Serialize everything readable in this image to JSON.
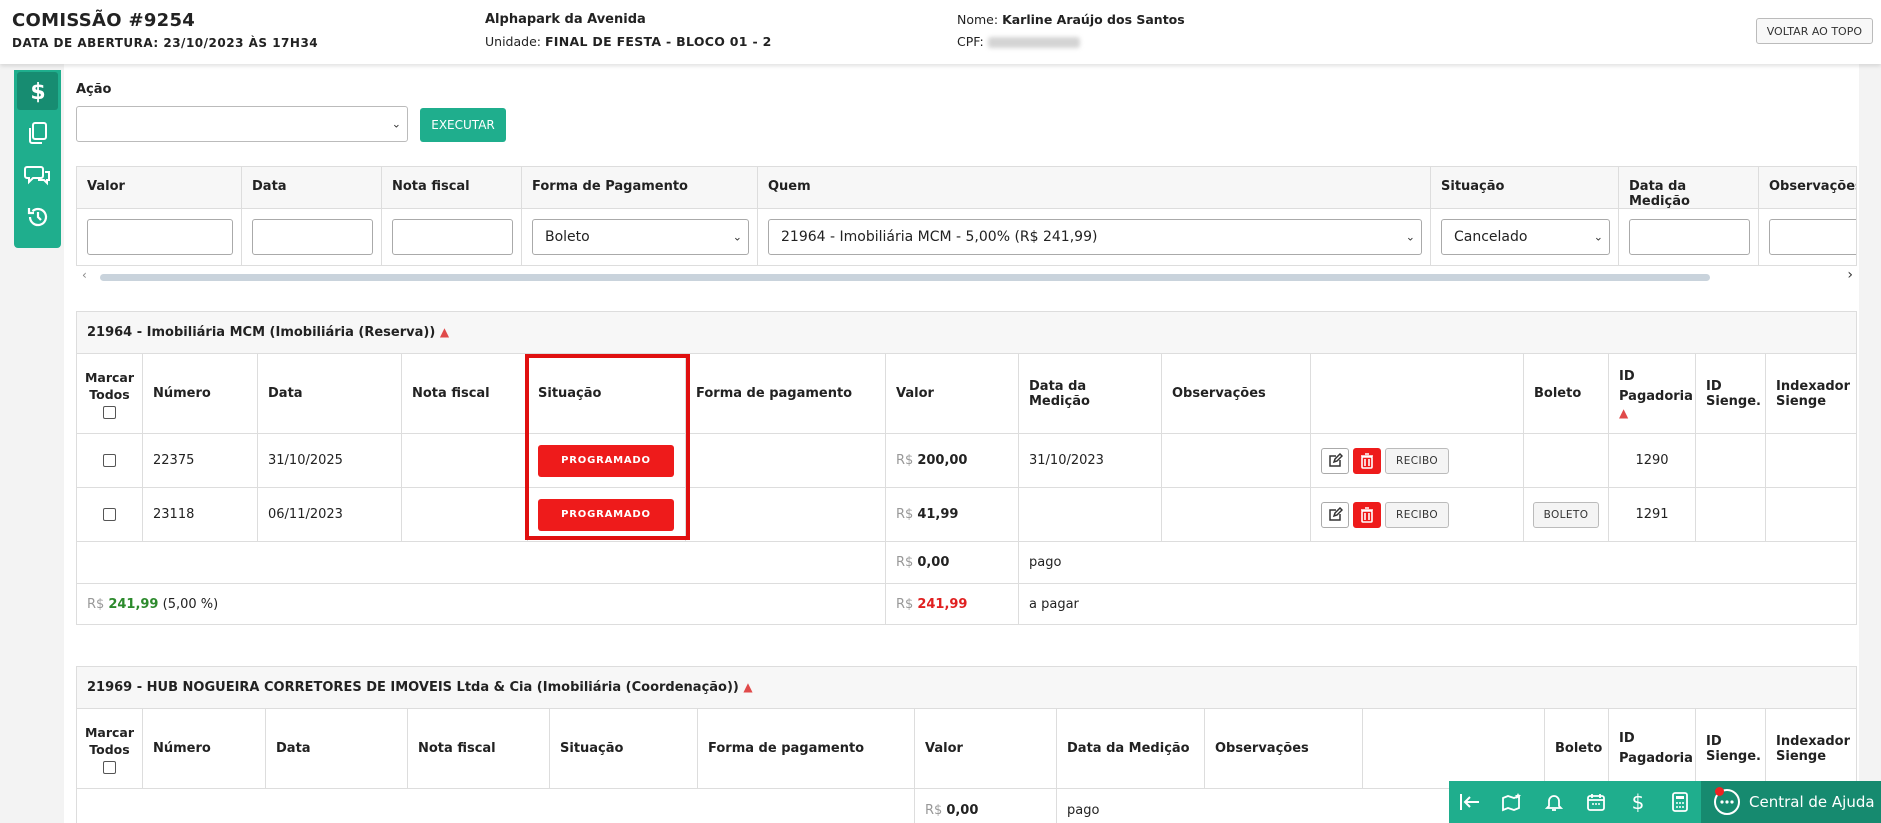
{
  "header": {
    "title": "COMISSÃO #9254",
    "opening": "DATA DE ABERTURA: 23/10/2023 ÀS 17H34",
    "project": "Alphapark da Avenida",
    "unit_label": "Unidade:",
    "unit_value": "FINAL DE FESTA - BLOCO 01 - 2",
    "name_label": "Nome:",
    "name_value": "Karline Araújo dos Santos",
    "cpf_label": "CPF:",
    "back_to_top": "VOLTAR AO TOPO"
  },
  "action": {
    "label": "Ação",
    "select_value": "",
    "execute": "EXECUTAR"
  },
  "filter": {
    "headers": [
      "Valor",
      "Data",
      "Nota fiscal",
      "Forma de Pagamento",
      "Quem",
      "Situação",
      "Data da Medição",
      "Observações"
    ],
    "forma_pagamento": "Boleto",
    "quem": "21964 - Imobiliária MCM - 5,00% (R$ 241,99)",
    "situacao": "Cancelado"
  },
  "group1": {
    "title": "21964 - Imobiliária MCM (Imobiliária (Reserva))",
    "headers": {
      "marcar": "Marcar Todos",
      "numero": "Número",
      "data": "Data",
      "nota": "Nota fiscal",
      "situacao": "Situação",
      "forma": "Forma de pagamento",
      "valor": "Valor",
      "medicao": "Data da Medição",
      "obs": "Observações",
      "boleto": "Boleto",
      "idpag": "ID Pagadoria",
      "idsienge": "ID Sienge.",
      "indexador": "Indexador Sienge"
    },
    "rows": [
      {
        "numero": "22375",
        "data": "31/10/2025",
        "situacao": "PROGRAMADO",
        "currency": "R$",
        "valor": "200,00",
        "medicao": "31/10/2023",
        "recibo": "RECIBO",
        "boleto": "",
        "idpag": "1290"
      },
      {
        "numero": "23118",
        "data": "06/11/2023",
        "situacao": "PROGRAMADO",
        "currency": "R$",
        "valor": "41,99",
        "medicao": "",
        "recibo": "RECIBO",
        "boleto": "BOLETO",
        "idpag": "1291"
      }
    ],
    "paid_currency": "R$",
    "paid_value": "0,00",
    "paid_label": "pago",
    "total_currency": "R$",
    "total_value": "241,99",
    "total_percent": "(5,00 %)",
    "topay_currency": "R$",
    "topay_value": "241,99",
    "topay_label": "a pagar"
  },
  "group2": {
    "title": "21969 - HUB NOGUEIRA CORRETORES DE IMOVEIS Ltda & Cia (Imobiliária (Coordenação))",
    "headers": {
      "marcar": "Marcar Todos",
      "numero": "Número",
      "data": "Data",
      "nota": "Nota fiscal",
      "situacao": "Situação",
      "forma": "Forma de pagamento",
      "valor": "Valor",
      "medicao": "Data da Medição",
      "obs": "Observações",
      "boleto": "Boleto",
      "idpag": "ID Pagadoria",
      "idsienge": "ID Sienge.",
      "indexador": "Indexador Sienge"
    },
    "paid_currency": "R$",
    "paid_value": "0,00",
    "paid_label": "pago"
  },
  "help": {
    "label": "Central de Ajuda"
  },
  "colors": {
    "accent": "#1fae8d",
    "danger": "#ee1b1b"
  },
  "icons": [
    "dollar-icon",
    "copy-icon",
    "chat-icon",
    "history-icon",
    "collapse-left-icon",
    "map-icon",
    "bell-icon",
    "calendar-icon",
    "dollar-icon",
    "calculator-icon",
    "help-chat-icon",
    "edit-icon",
    "trash-icon",
    "warning-icon"
  ]
}
